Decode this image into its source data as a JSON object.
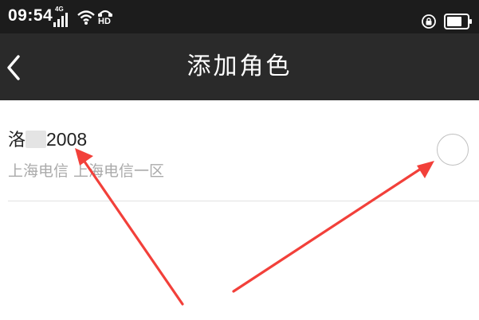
{
  "status_bar": {
    "time": "09:54",
    "network_label": "4G",
    "hd_label": "HD",
    "icons": [
      "signal-icon",
      "wifi-icon",
      "hd-call-icon",
      "rotation-lock-icon",
      "battery-icon"
    ]
  },
  "nav": {
    "title": "添加角色",
    "back_icon": "chevron-left-icon"
  },
  "role": {
    "name_prefix": "洛",
    "name_suffix": "2008",
    "server_info": "上海电信 上海电信一区",
    "selected": false
  },
  "annotation": {
    "arrow_color": "#f2403a"
  },
  "colors": {
    "status_bar_bg": "#1c1c1c",
    "nav_bg": "#2a2a2a",
    "primary_text": "#222222",
    "secondary_text": "#aaaaaa",
    "divider": "#e2e2e2"
  }
}
